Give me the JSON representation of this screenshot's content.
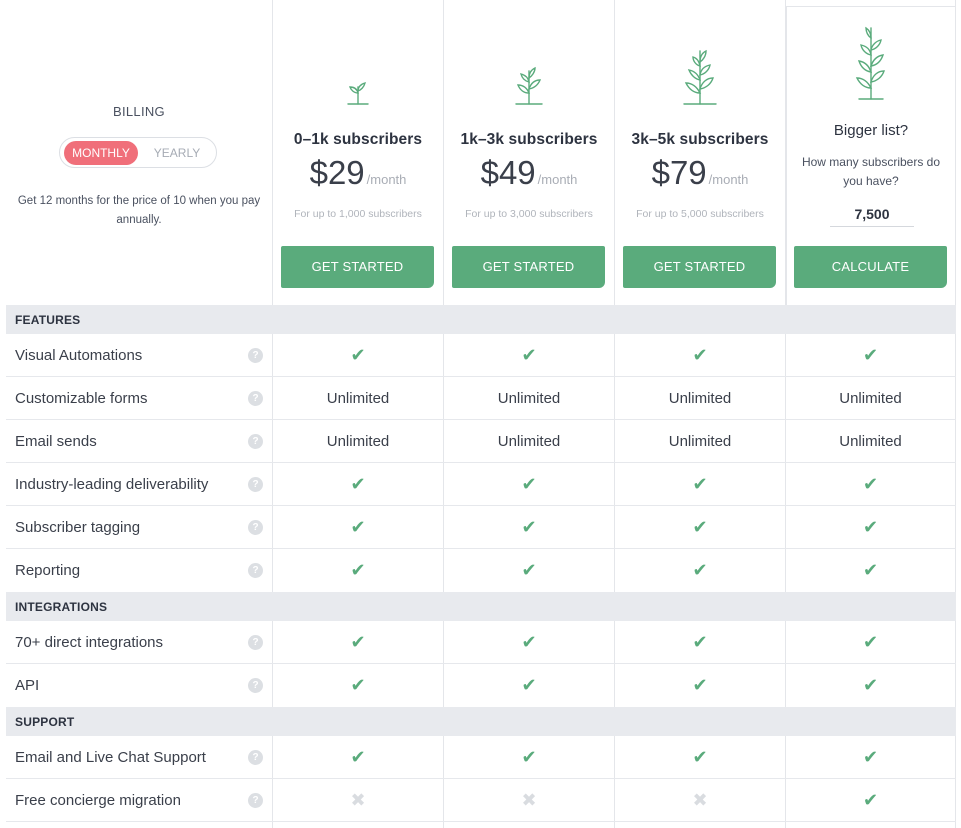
{
  "billing": {
    "label": "BILLING",
    "options": [
      "MONTHLY",
      "YEARLY"
    ],
    "selected": "MONTHLY",
    "note": "Get 12 months for the price of 10 when you pay annually."
  },
  "plans": [
    {
      "name": "0–1k subscribers",
      "price": "$29",
      "period": "/month",
      "sub": "For up to 1,000 subscribers",
      "cta": "GET STARTED"
    },
    {
      "name": "1k–3k subscribers",
      "price": "$49",
      "period": "/month",
      "sub": "For up to 3,000 subscribers",
      "cta": "GET STARTED"
    },
    {
      "name": "3k–5k subscribers",
      "price": "$79",
      "period": "/month",
      "sub": "For up to 5,000 subscribers",
      "cta": "GET STARTED"
    }
  ],
  "bigger": {
    "title": "Bigger list?",
    "question": "How many subscribers do you have?",
    "value": "7,500",
    "cta": "CALCULATE"
  },
  "colors": {
    "accent": "#5aab7c",
    "toggle_active": "#f06f7a",
    "section_bg": "#e8eaee"
  },
  "icons": {
    "included": "check-icon",
    "excluded": "cross-icon",
    "help": "help-icon",
    "plan": "plant-icon"
  },
  "sections": [
    {
      "title": "FEATURES",
      "rows": [
        {
          "label": "Visual Automations",
          "values": [
            "check",
            "check",
            "check",
            "check"
          ]
        },
        {
          "label": "Customizable forms",
          "values": [
            "Unlimited",
            "Unlimited",
            "Unlimited",
            "Unlimited"
          ]
        },
        {
          "label": "Email sends",
          "values": [
            "Unlimited",
            "Unlimited",
            "Unlimited",
            "Unlimited"
          ]
        },
        {
          "label": "Industry-leading deliverability",
          "values": [
            "check",
            "check",
            "check",
            "check"
          ]
        },
        {
          "label": "Subscriber tagging",
          "values": [
            "check",
            "check",
            "check",
            "check"
          ]
        },
        {
          "label": "Reporting",
          "values": [
            "check",
            "check",
            "check",
            "check"
          ]
        }
      ]
    },
    {
      "title": "INTEGRATIONS",
      "rows": [
        {
          "label": "70+ direct integrations",
          "values": [
            "check",
            "check",
            "check",
            "check"
          ]
        },
        {
          "label": "API",
          "values": [
            "check",
            "check",
            "check",
            "check"
          ]
        }
      ]
    },
    {
      "title": "SUPPORT",
      "rows": [
        {
          "label": "Email and Live Chat Support",
          "values": [
            "check",
            "check",
            "check",
            "check"
          ]
        },
        {
          "label": "Free concierge migration",
          "values": [
            "cross",
            "cross",
            "cross",
            "check"
          ]
        }
      ]
    }
  ]
}
